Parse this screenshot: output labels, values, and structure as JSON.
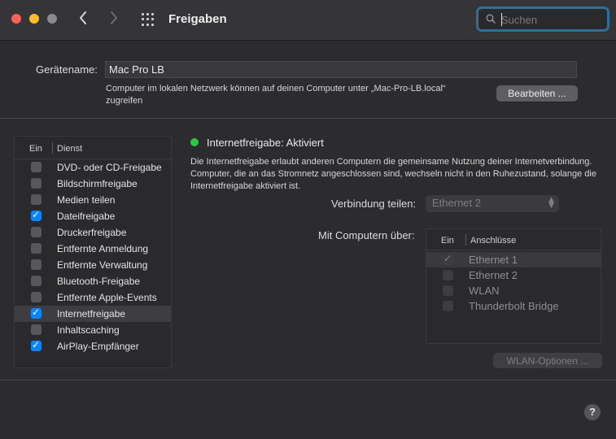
{
  "window": {
    "title": "Freigaben",
    "traffic_colors": {
      "close": "#fe5f57",
      "minimize": "#febc2e",
      "maximize": "#8a898c"
    },
    "nav_back_icon": "chevron-left-icon",
    "nav_forward_icon": "chevron-right-icon",
    "grid_icon": "show-all-grid-icon"
  },
  "search": {
    "placeholder": "Suchen",
    "value": "",
    "icon": "magnifier-icon"
  },
  "device": {
    "label": "Gerätename:",
    "value": "Mac Pro LB",
    "note": "Computer im lokalen Netzwerk können auf deinen Computer unter „Mac-Pro-LB.local“ zugreifen",
    "edit_button": "Bearbeiten ..."
  },
  "services": {
    "col_on": "Ein",
    "col_service": "Dienst",
    "items": [
      {
        "label": "DVD- oder CD-Freigabe",
        "checked": false,
        "selected": false
      },
      {
        "label": "Bildschirmfreigabe",
        "checked": false,
        "selected": false
      },
      {
        "label": "Medien teilen",
        "checked": false,
        "selected": false
      },
      {
        "label": "Dateifreigabe",
        "checked": true,
        "selected": false
      },
      {
        "label": "Druckerfreigabe",
        "checked": false,
        "selected": false
      },
      {
        "label": "Entfernte Anmeldung",
        "checked": false,
        "selected": false
      },
      {
        "label": "Entfernte Verwaltung",
        "checked": false,
        "selected": false
      },
      {
        "label": "Bluetooth-Freigabe",
        "checked": false,
        "selected": false
      },
      {
        "label": "Entfernte Apple-Events",
        "checked": false,
        "selected": false
      },
      {
        "label": "Internetfreigabe",
        "checked": true,
        "selected": true
      },
      {
        "label": "Inhaltscaching",
        "checked": false,
        "selected": false
      },
      {
        "label": "AirPlay-Empfänger",
        "checked": true,
        "selected": false
      }
    ]
  },
  "detail": {
    "status": "Internetfreigabe: Aktiviert",
    "status_color": "#28c840",
    "description": "Die Internetfreigabe erlaubt anderen Computern die gemeinsame Nutzung deiner Internetverbindung. Computer, die an das Stromnetz angeschlossen sind, wechseln nicht in den Ruhezustand, solange die Internetfreigabe aktiviert ist.",
    "share_label": "Verbindung teilen:",
    "share_value": "Ethernet 2",
    "via_label": "Mit Computern über:",
    "ports_col_on": "Ein",
    "ports_col_ports": "Anschlüsse",
    "ports": [
      {
        "label": "Ethernet 1",
        "checked": true,
        "selected": true
      },
      {
        "label": "Ethernet 2",
        "checked": false,
        "selected": false
      },
      {
        "label": "WLAN",
        "checked": false,
        "selected": false
      },
      {
        "label": "Thunderbolt Bridge",
        "checked": false,
        "selected": false
      }
    ],
    "wlan_button": "WLAN-Optionen ..."
  },
  "help": {
    "label": "?"
  },
  "colors": {
    "accent": "#0a84ff",
    "search_focus": "#2f6f9a"
  }
}
